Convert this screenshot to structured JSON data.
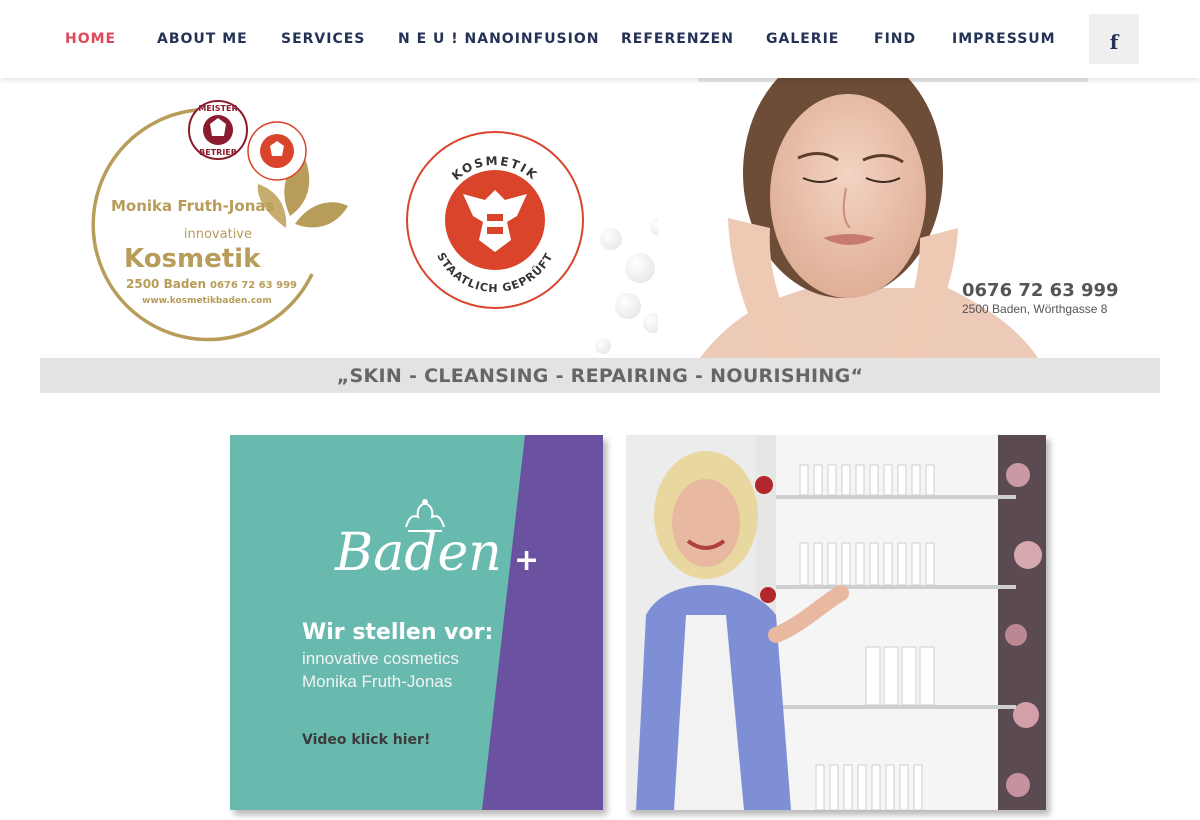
{
  "nav": {
    "items": [
      {
        "label": "HOME",
        "active": true
      },
      {
        "label": "ABOUT ME"
      },
      {
        "label": "SERVICES"
      },
      {
        "label": "N E U ! NANOINFUSION"
      },
      {
        "label": "REFERENZEN"
      },
      {
        "label": "GALERIE"
      },
      {
        "label": "FIND"
      },
      {
        "label": "IMPRESSUM"
      }
    ],
    "facebook_icon": "facebook-icon",
    "facebook_glyph": "f"
  },
  "header": {
    "logo": {
      "name": "Monika Fruth-Jonas",
      "line1": "innovative",
      "line2": "Kosmetik",
      "city_phone": "2500 Baden",
      "phone": "0676 72 63 999",
      "website": "www.kosmetikbaden.com",
      "seal_top": "MEISTER",
      "seal_bottom": "BETRIEB"
    },
    "badge": {
      "top": "KOSMETIK",
      "bottom": "STAATLICH GEPRÜFT"
    },
    "contact": {
      "phone": "0676 72 63 999",
      "address": "2500 Baden, Wörthgasse 8"
    },
    "tagline": "„SKIN - CLEANSING - REPAIRING - NOURISHING“"
  },
  "promo": {
    "brand": "Baden",
    "brand_plus": "+",
    "intro": "Wir stellen vor:",
    "subtitle_1": "innovative cosmetics",
    "subtitle_2": "Monika Fruth-Jonas",
    "cta": "Video klick hier!"
  },
  "colors": {
    "nav_text": "#253257",
    "nav_active": "#e0485a",
    "gold": "#b89c5a",
    "red_emblem": "#d9442b",
    "teal": "#68b9ae",
    "purple": "#6a52a1",
    "tagline_bg": "#e3e3e3"
  }
}
